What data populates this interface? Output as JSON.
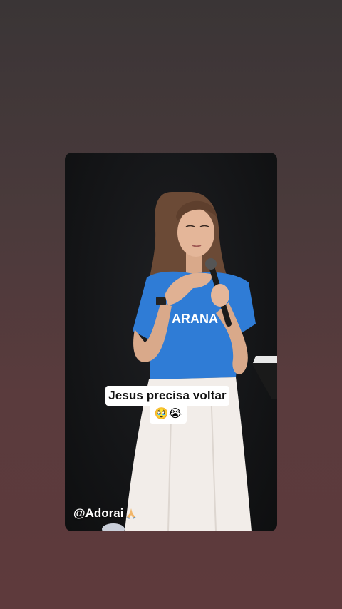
{
  "story": {
    "caption": "Jesus precisa voltar",
    "emojis": "🥹😭",
    "handle": "@Adorai",
    "shirt_text": "ARANA"
  },
  "colors": {
    "background_top": "#3a3536",
    "background_bottom": "#5e3a3c",
    "shirt_blue": "#2f7cd6",
    "skirt_white": "#f2ede9",
    "caption_bg": "#ffffff"
  },
  "icons": {
    "handle_icon": "praying-hands-icon"
  }
}
